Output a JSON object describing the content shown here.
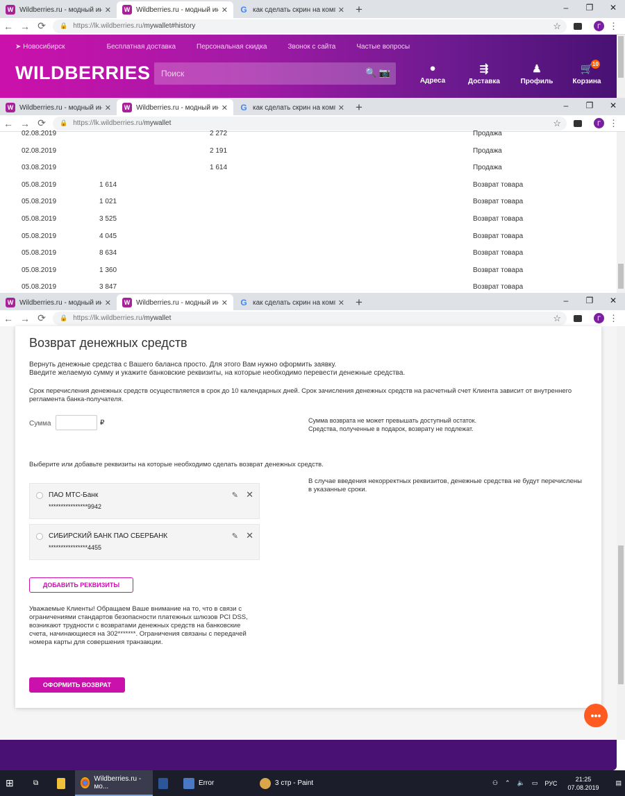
{
  "tabs": [
    {
      "title": "Wildberries.ru - модный интерне",
      "icon": "wildberries-favicon",
      "active": false
    },
    {
      "title": "Wildberries.ru - модный интерне",
      "icon": "wildberries-favicon",
      "active": true
    },
    {
      "title": "как сделать скрин на компьюте",
      "icon": "google-favicon",
      "active": false
    }
  ],
  "browser": {
    "url1_host": "https://lk.wildberries.ru/",
    "url1_path": "mywallet#history",
    "url2_host": "https://lk.wildberries.ru/",
    "url2_path": "mywallet",
    "url3_host": "https://lk.wildberries.ru/",
    "url3_path": "mywallet",
    "profile_initial": "Г",
    "win_min": "–",
    "win_max": "❐",
    "win_close": "✕"
  },
  "header": {
    "city": "Новосибирск",
    "links": [
      "Бесплатная доставка",
      "Персональная скидка",
      "Звонок с сайта",
      "Частые вопросы"
    ],
    "logo": "WILDBERRIES",
    "search_placeholder": "Поиск",
    "icons": [
      {
        "label": "Адреса",
        "icon": "location-pin-icon"
      },
      {
        "label": "Доставка",
        "icon": "delivery-truck-icon"
      },
      {
        "label": "Профиль",
        "icon": "user-icon"
      },
      {
        "label": "Корзина",
        "icon": "cart-icon"
      }
    ],
    "cart_count": "10",
    "brand_color": "#cb11ab"
  },
  "transactions": [
    {
      "date": "02.08.2019",
      "credit": "",
      "debit": "2 272",
      "type": "Продажа"
    },
    {
      "date": "02.08.2019",
      "credit": "",
      "debit": "2 191",
      "type": "Продажа"
    },
    {
      "date": "03.08.2019",
      "credit": "",
      "debit": "1 614",
      "type": "Продажа"
    },
    {
      "date": "05.08.2019",
      "credit": "1 614",
      "debit": "",
      "type": "Возврат товара"
    },
    {
      "date": "05.08.2019",
      "credit": "1 021",
      "debit": "",
      "type": "Возврат товара"
    },
    {
      "date": "05.08.2019",
      "credit": "3 525",
      "debit": "",
      "type": "Возврат товара"
    },
    {
      "date": "05.08.2019",
      "credit": "4 045",
      "debit": "",
      "type": "Возврат товара"
    },
    {
      "date": "05.08.2019",
      "credit": "8 634",
      "debit": "",
      "type": "Возврат товара"
    },
    {
      "date": "05.08.2019",
      "credit": "1 360",
      "debit": "",
      "type": "Возврат товара"
    },
    {
      "date": "05.08.2019",
      "credit": "3 847",
      "debit": "",
      "type": "Возврат товара"
    }
  ],
  "refund": {
    "title": "Возврат денежных средств",
    "intro1": "Вернуть денежные средства с Вашего баланса просто. Для этого Вам нужно оформить заявку.",
    "intro2": "Введите желаемую сумму и укажите банковские реквизиты, на которые необходимо перевести денежные средства.",
    "term": "Срок перечисления денежных средств осуществляется в срок до 10 календарных дней. Срок зачисления денежных средств на расчетный счет Клиента зависит от внутреннего регламента банка-получателя.",
    "amount_label": "Сумма",
    "amount_value": "",
    "currency": "₽",
    "note1": "Сумма возврата не может превышать доступный остаток.",
    "note2": "Средства, полученные в подарок, возврату не подлежат.",
    "choose_text": "Выберите или добавьте реквизиты на которые необходимо сделать возврат денежных средств.",
    "warning": "В случае введения некорректных реквизитов, денежные средства не будут перечислены в указанные сроки.",
    "requisites": [
      {
        "bank": "ПАО МТС-Банк",
        "account": "****************9942"
      },
      {
        "bank": "СИБИРСКИЙ БАНК ПАО СБЕРБАНК",
        "account": "****************4455"
      }
    ],
    "add_button": "ДОБАВИТЬ РЕКВИЗИТЫ",
    "pci_note": "Уважаемые Клиенты! Обращаем Ваше внимание на то, что в связи с ограничениями стандартов безопасности платежных шлюзов PCI DSS, возникают трудности с возвратами денежных средств на банковские счета, начинающиеся на 302*******. Ограничения связаны с передачей номера карты для совершения транзакции.",
    "submit_button": "ОФОРМИТЬ ВОЗВРАТ"
  },
  "taskbar": {
    "items": [
      {
        "label": "Wildberries.ru - мо...",
        "icon": "chrome-icon",
        "active": true
      },
      {
        "label": "",
        "icon": "word-icon",
        "active": false
      },
      {
        "label": "Error",
        "icon": "window-icon",
        "active": false
      },
      {
        "label": "3 стр - Paint",
        "icon": "paint-icon",
        "active": false
      }
    ],
    "lang": "РУС",
    "time": "21:25",
    "date": "07.08.2019"
  }
}
